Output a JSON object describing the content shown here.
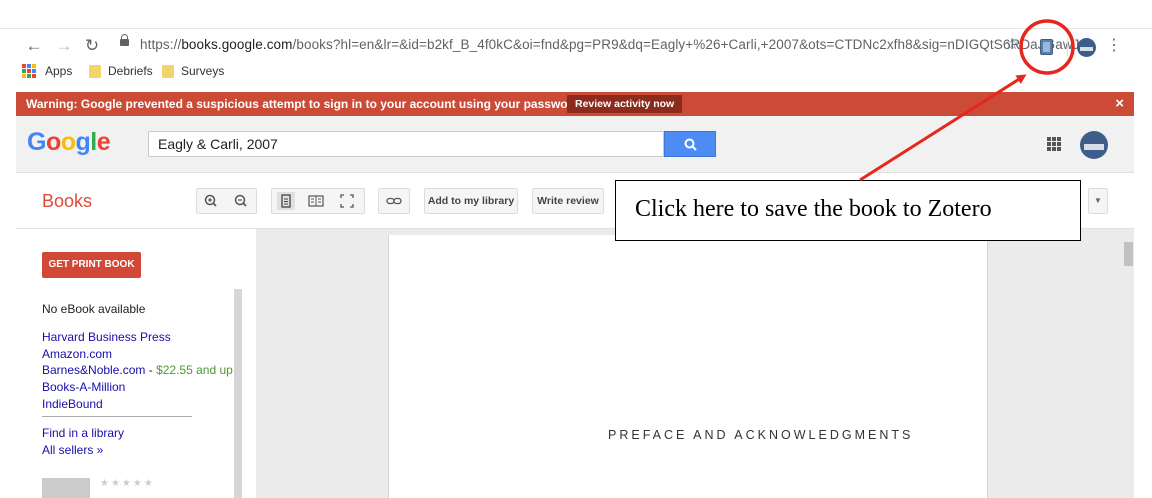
{
  "browser": {
    "url_prefix": "https://",
    "url_host": "books.google.com",
    "url_rest": "/books?hl=en&lr=&id=b2kf_B_4f0kC&oi=fnd&pg=PR9&dq=Eagly+%26+Carli,+2007&ots=CTDNc2xfh8&sig=nDIGQtS6RDaJGawJ...",
    "bookmarks": [
      "Apps",
      "Debriefs",
      "Surveys"
    ]
  },
  "warning": {
    "text": "Warning: Google prevented a suspicious attempt to sign in to your account using your password.",
    "button": "Review activity now",
    "close": "×"
  },
  "google": {
    "search_value": "Eagly & Carli, 2007",
    "logo_letters": [
      "G",
      "o",
      "o",
      "g",
      "l",
      "e"
    ]
  },
  "books": {
    "title": "Books",
    "add_library": "Add to my library",
    "write_review": "Write review"
  },
  "sidebar": {
    "print_button": "GET PRINT BOOK",
    "no_ebook": "No eBook available",
    "sellers": [
      "Harvard Business Press",
      "Amazon.com"
    ],
    "barnes": "Barnes&Noble.com",
    "barnes_sep": " - ",
    "barnes_price": "$22.55 and up",
    "sellers2": [
      "Books-A-Million",
      "IndieBound"
    ],
    "find_library": "Find in a library",
    "all_sellers": "All sellers »"
  },
  "page": {
    "heading": "PREFACE AND ACKNOWLEDGMENTS"
  },
  "callout": {
    "text": "Click here to save the book to Zotero"
  },
  "colors": {
    "warning_bar": "#cb4b36",
    "annotation_red": "#e5271e",
    "search_blue": "#4d8cf5"
  }
}
